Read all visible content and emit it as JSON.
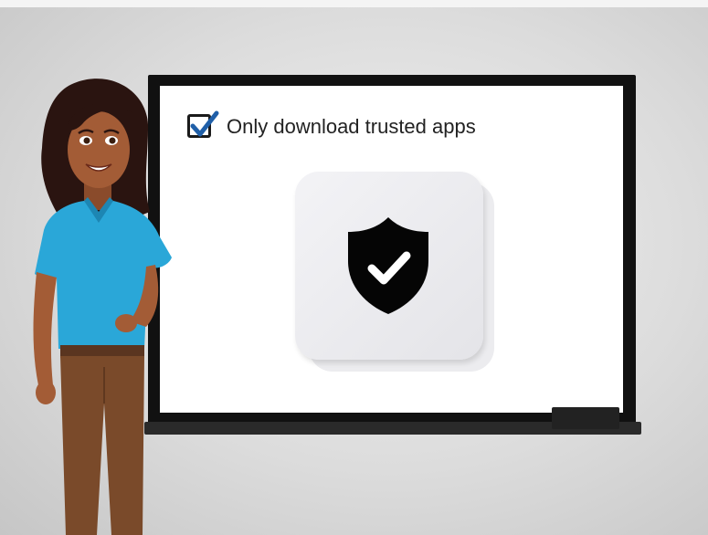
{
  "slide": {
    "checklist_item": {
      "checked": true,
      "label": "Only download trusted apps"
    },
    "app_icon": {
      "icon": "shield-check-icon"
    },
    "colors": {
      "checkmark": "#1f5fa8",
      "shirt": "#2aa7d8",
      "pants": "#7a4a2a"
    }
  }
}
